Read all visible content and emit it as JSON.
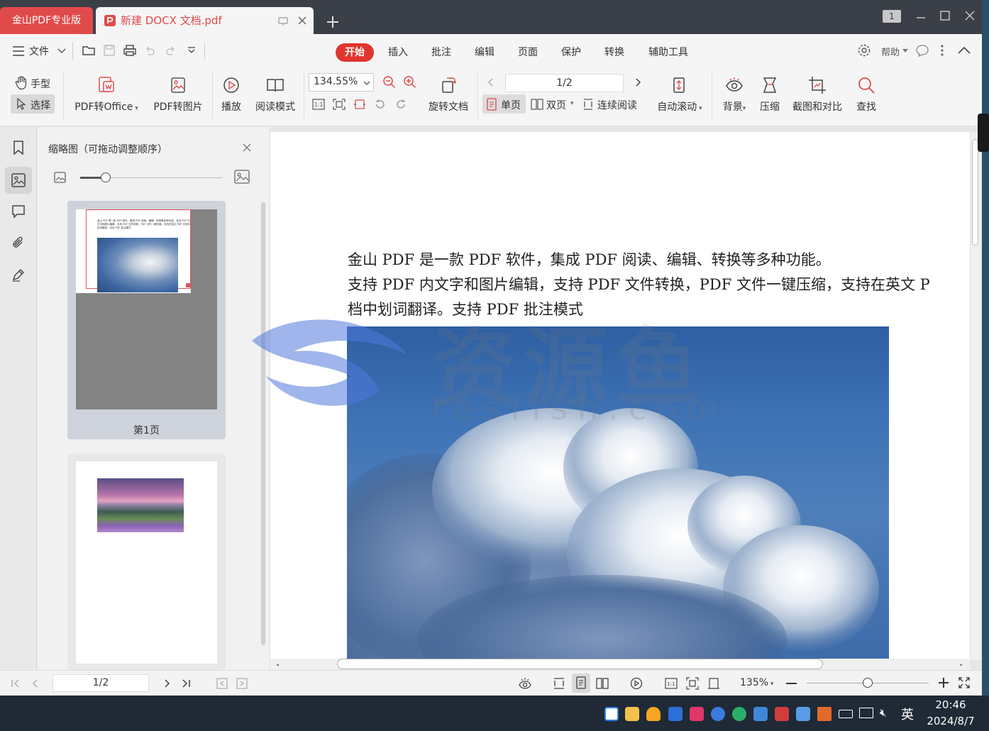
{
  "title_bar": {
    "app_tab": "金山PDF专业版",
    "doc_tab": "新建 DOCX 文档.pdf",
    "counter": "1"
  },
  "menu_bar": {
    "file_label": "文件",
    "tabs": [
      "开始",
      "插入",
      "批注",
      "编辑",
      "页面",
      "保护",
      "转换",
      "辅助工具"
    ],
    "active_tab": "开始",
    "help_label": "帮助"
  },
  "ribbon": {
    "hand_tool": "手型",
    "select_tool": "选择",
    "pdf_to_office": "PDF转Office",
    "pdf_to_image": "PDF转图片",
    "play": "播放",
    "read_mode": "阅读模式",
    "zoom_value": "134.55%",
    "rotate_doc": "旋转文档",
    "page_input": "1/2",
    "single_page": "单页",
    "double_page": "双页",
    "continuous": "连续阅读",
    "auto_scroll": "自动滚动",
    "background": "背景",
    "compress": "压缩",
    "screenshot_compare": "截图和对比",
    "find": "查找"
  },
  "thumbnail_panel": {
    "title": "缩略图（可拖动调整顺序）",
    "page1_label": "第1页",
    "page1_mini_text": "金山 PDF 是一款 PDF 软件，集成 PDF 阅读、编辑、转换等多种功能。支持 PDF 内文字和图片编辑，支持 PDF 文件转换，PDF 文件一键压缩，支持在英文 PDF 文档中划词翻译。支持 PDF 批注模式",
    "slider_level": 0.18
  },
  "document": {
    "line1": "金山 PDF 是一款 PDF 软件，集成 PDF 阅读、编辑、转换等多种功能。",
    "line2": "支持 PDF 内文字和图片编辑，支持 PDF 文件转换，PDF 文件一键压缩，支持在英文 P",
    "line3": "档中划词翻译。支持 PDF 批注模式",
    "watermark_cn": "资源鱼",
    "watermark_en": "resfish.com"
  },
  "status_bar": {
    "page_input": "1/2",
    "zoom": "135%",
    "zoom_slider_level": 0.5
  },
  "taskbar": {
    "ime": "英",
    "time": "20:46",
    "date": "2024/8/7"
  },
  "colors": {
    "accent": "#e0362f",
    "titlebar": "#3b3f47",
    "panel": "#f1f1f1",
    "taskbar": "#1f2a36"
  }
}
